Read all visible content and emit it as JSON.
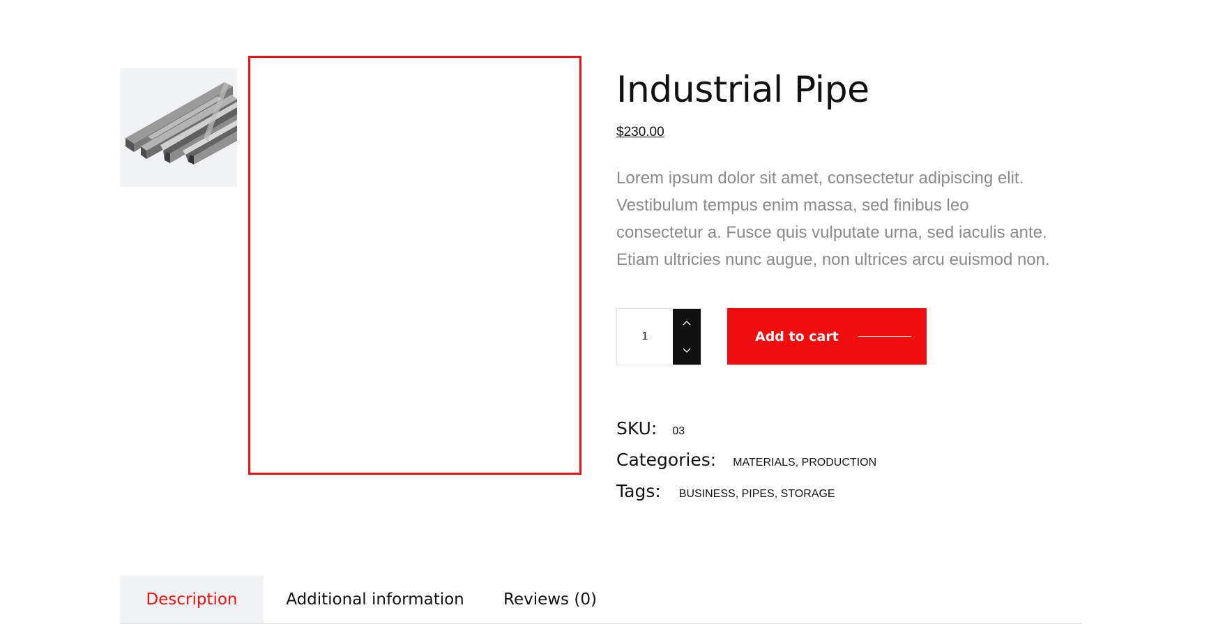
{
  "gallery": {
    "thumbnail_icon": "steel-angle-bars-image",
    "main_image_highlight_color": "#ee1111"
  },
  "product": {
    "title": "Industrial Pipe",
    "price": "$230.00",
    "description": "Lorem ipsum dolor sit amet, consectetur adipiscing elit. Vestibulum tempus enim massa, sed finibus leo consectetur a. Fusce quis vulputate urna, sed iaculis ante. Etiam ultricies nunc augue, non ultrices arcu euismod non."
  },
  "cart": {
    "quantity": "1",
    "increment_icon": "chevron-up-icon",
    "decrement_icon": "chevron-down-icon",
    "add_to_cart_label": "Add to cart",
    "button_color": "#f00d0d"
  },
  "meta": {
    "sku_label": "SKU:",
    "sku_value": "03",
    "categories_label": "Categories:",
    "categories_value": "MATERIALS, PRODUCTION",
    "tags_label": "Tags:",
    "tags_value": "BUSINESS, PIPES, STORAGE"
  },
  "tabs": [
    {
      "label": "Description",
      "active": true
    },
    {
      "label": "Additional information",
      "active": false
    },
    {
      "label": "Reviews (0)",
      "active": false
    }
  ]
}
